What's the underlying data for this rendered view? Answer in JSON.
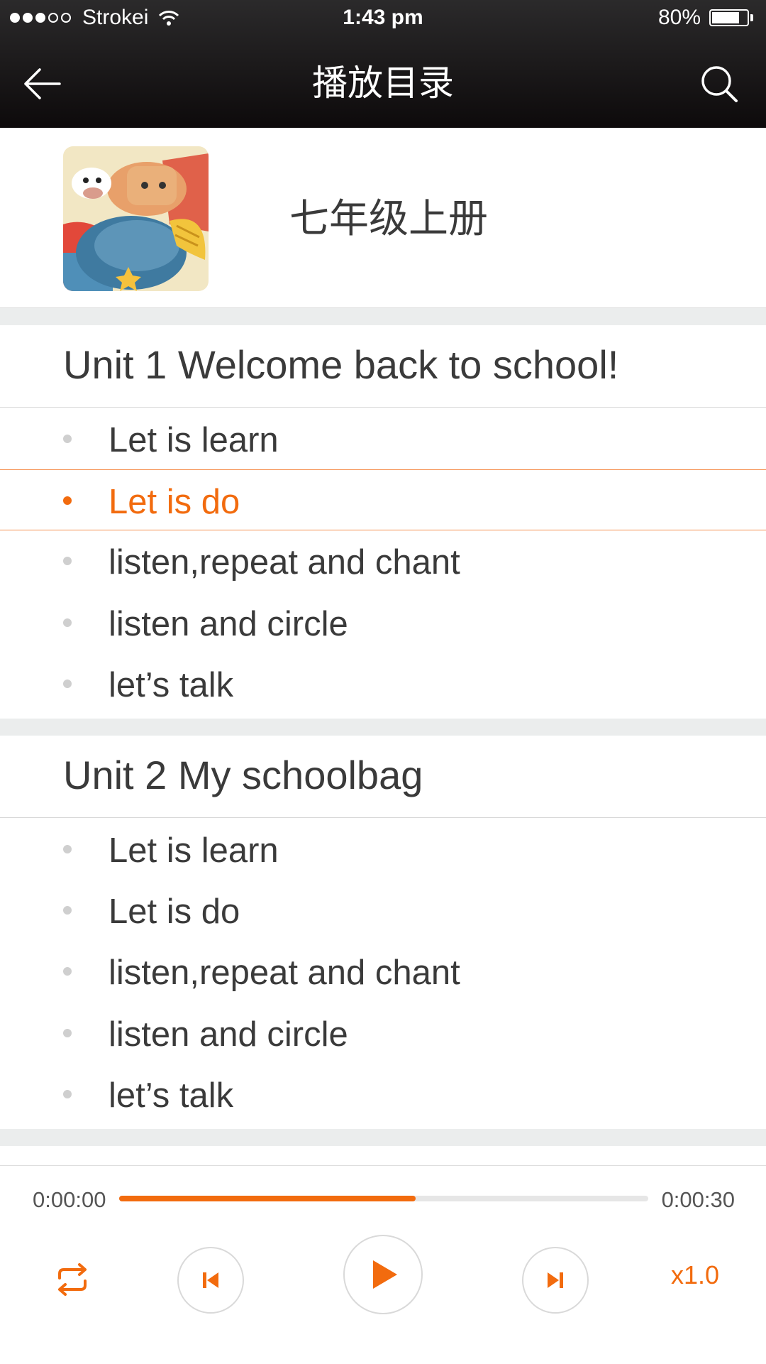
{
  "status_bar": {
    "carrier": "Strokei",
    "time": "1:43 pm",
    "battery": "80%",
    "battery_level": 0.8,
    "signal_bars_filled": 3,
    "signal_bars_total": 5
  },
  "header": {
    "title": "播放目录",
    "back_icon": "back-arrow-icon",
    "search_icon": "search-icon"
  },
  "album": {
    "title": "七年级上册"
  },
  "units": [
    {
      "title": "Unit 1 Welcome back to school!",
      "tracks": [
        {
          "label": "Let is learn",
          "active": false
        },
        {
          "label": "Let is do",
          "active": true
        },
        {
          "label": "listen,repeat and chant",
          "active": false
        },
        {
          "label": "listen and circle",
          "active": false
        },
        {
          "label": "let’s talk",
          "active": false
        }
      ]
    },
    {
      "title": "Unit 2 My schoolbag",
      "tracks": [
        {
          "label": "Let is learn",
          "active": false
        },
        {
          "label": "Let is do",
          "active": false
        },
        {
          "label": "listen,repeat and chant",
          "active": false
        },
        {
          "label": "listen and circle",
          "active": false
        },
        {
          "label": "let’s talk",
          "active": false
        }
      ]
    }
  ],
  "player": {
    "current_time": "0:00:00",
    "total_time": "0:00:30",
    "progress": 0.56,
    "speed": "x1.0",
    "icons": [
      "repeat-icon",
      "previous-icon",
      "play-icon",
      "next-icon"
    ]
  },
  "colors": {
    "accent": "#f26b0e",
    "header_bg": "#1a1718",
    "divider": "#ebeded",
    "text": "#3a3a3a",
    "bullet_inactive": "#cfcfcf"
  }
}
